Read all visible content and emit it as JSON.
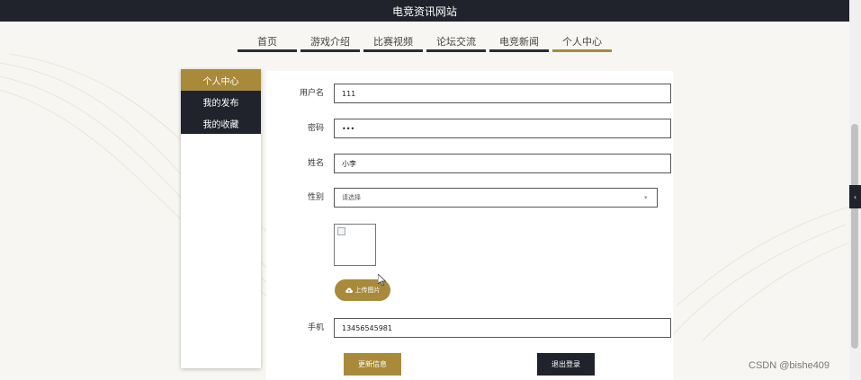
{
  "site": {
    "title": "电竞资讯网站"
  },
  "nav": {
    "items": [
      {
        "label": "首页"
      },
      {
        "label": "游戏介绍"
      },
      {
        "label": "比赛视频"
      },
      {
        "label": "论坛交流"
      },
      {
        "label": "电竞新闻"
      },
      {
        "label": "个人中心"
      }
    ],
    "active": "个人中心"
  },
  "sidebar": {
    "items": [
      {
        "label": "个人中心"
      },
      {
        "label": "我的发布"
      },
      {
        "label": "我的收藏"
      }
    ]
  },
  "form": {
    "username": {
      "label": "用户名",
      "value": "111"
    },
    "password": {
      "label": "密码",
      "value": "•••"
    },
    "name": {
      "label": "姓名",
      "value": "小李"
    },
    "gender": {
      "label": "性别",
      "placeholder": "请选择"
    },
    "upload_label": "上传图片",
    "phone": {
      "label": "手机",
      "value": "13456545981"
    },
    "update_label": "更新信息",
    "logout_label": "退出登录"
  },
  "watermark": "CSDN @bishe409",
  "colors": {
    "accent": "#a88a3a",
    "dark": "#20232c"
  },
  "icons": {
    "upload": "cloud-upload-icon",
    "side_tab": "chevron-left-icon",
    "select": "chevron-down-icon"
  }
}
